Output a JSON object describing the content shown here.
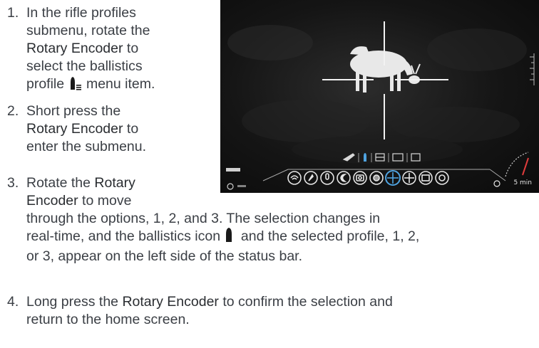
{
  "steps": [
    {
      "number": "1.",
      "line1": "In the rifle profiles",
      "line2": "submenu, rotate the",
      "line3_emph": "Rotary Encoder",
      "line3_rest": " to",
      "line4": "select the ballistics",
      "line5_a": "profile ",
      "line5_icon": "ballistics-profile-icon",
      "line5_b": " menu item."
    },
    {
      "number": "2.",
      "line1": "Short press the",
      "line2_emph": "Rotary Encoder",
      "line2_rest": " to",
      "line3": "enter the submenu."
    },
    {
      "number": "3.",
      "line1_a": "Rotate the ",
      "line1_emph": "Rotary",
      "line2_emph": "Encoder",
      "line2_rest": " to move",
      "line3": "through the options, 1, 2, and 3. The selection changes in",
      "line4_a": "real-time, and the ballistics icon ",
      "line4_icon": "bullet-icon",
      "line4_b": " and the selected profile, 1, 2,",
      "line5": "or 3, appear on the left side of the status bar."
    },
    {
      "number": "4.",
      "line1_a": "Long press the ",
      "line1_emph": "Rotary Encoder",
      "line1_b": " to confirm the selection and",
      "line2": "return to the home screen."
    }
  ],
  "screen": {
    "timer_label": "5 min",
    "menu_icons": [
      "wifi-icon",
      "compass-icon",
      "microphone-icon",
      "night-mode-icon",
      "camera-icon",
      "color-palette-icon",
      "reticle-selected-icon",
      "crosshair-icon",
      "gallery-icon",
      "settings-icon"
    ],
    "submenu_icons": [
      "rifle-icon",
      "ballistics-profile-icon",
      "zeroing-icon",
      "grid-icon",
      "profile-icon"
    ]
  }
}
